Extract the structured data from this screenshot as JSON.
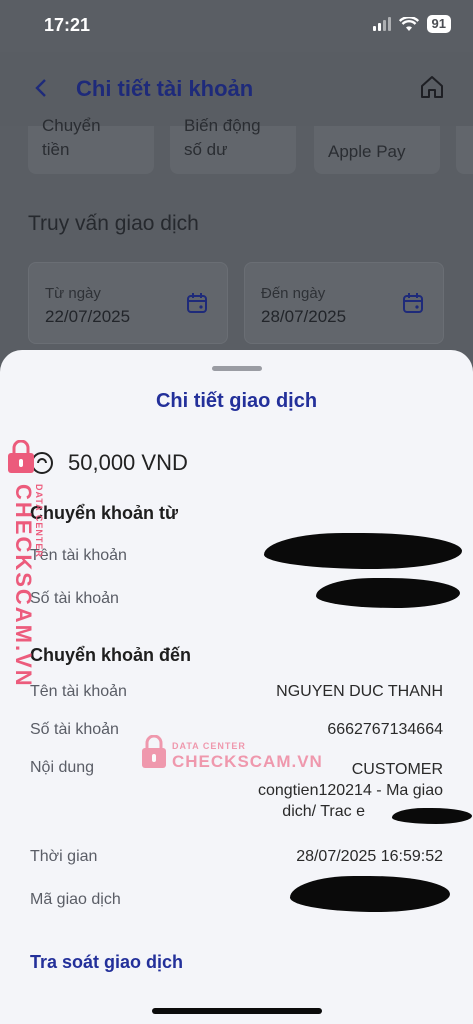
{
  "status_bar": {
    "time": "17:21",
    "battery": "91"
  },
  "header": {
    "title": "Chi tiết tài khoản"
  },
  "quick_actions": [
    {
      "line1": "Chuyển",
      "line2": "tiền"
    },
    {
      "line1": "Biến động",
      "line2": "số dư"
    },
    {
      "line1": "Apple Pay",
      "line2": ""
    }
  ],
  "query": {
    "title": "Truy vấn giao dịch",
    "from_label": "Từ ngày",
    "from_value": "22/07/2025",
    "to_label": "Đến ngày",
    "to_value": "28/07/2025"
  },
  "sheet": {
    "title": "Chi tiết giao dịch",
    "amount": "50,000 VND",
    "from_section": {
      "title": "Chuyển khoản từ",
      "name_label": "Tên tài khoản",
      "number_label": "Số tài khoản"
    },
    "to_section": {
      "title": "Chuyển khoản đến",
      "name_label": "Tên tài khoản",
      "name_value": "NGUYEN DUC THANH",
      "number_label": "Số tài khoản",
      "number_value": "6662767134664",
      "content_label": "Nội dung",
      "content_lines": [
        "CUSTOMER",
        "congtien120214 - Ma giao",
        "dich/ Trac e"
      ],
      "time_label": "Thời gian",
      "time_value": "28/07/2025 16:59:52",
      "txn_label": "Mã giao dịch"
    },
    "link": "Tra soát giao dịch"
  },
  "watermark": {
    "brand": "CHECKSCAM.VN",
    "tagline": "DATA CENTER"
  },
  "colors": {
    "accent": "#23309a",
    "watermark": "#ec5b7c"
  }
}
